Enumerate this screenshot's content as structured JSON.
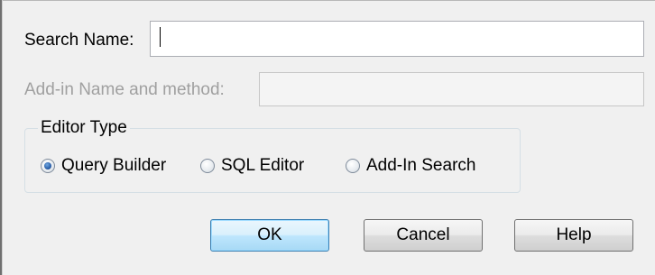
{
  "search_name": {
    "label": "Search Name:",
    "value": ""
  },
  "addin": {
    "label": "Add-in Name and method:",
    "value": "",
    "disabled": true
  },
  "editor_type": {
    "title": "Editor Type",
    "options": [
      {
        "label": "Query Builder",
        "checked": true
      },
      {
        "label": "SQL Editor",
        "checked": false
      },
      {
        "label": "Add-In Search",
        "checked": false
      }
    ]
  },
  "buttons": {
    "ok": "OK",
    "cancel": "Cancel",
    "help": "Help"
  },
  "colors": {
    "dialog_bg": "#f0f0f0",
    "default_button_border": "#3c7fb1",
    "disabled_text": "#a0a0a0"
  }
}
